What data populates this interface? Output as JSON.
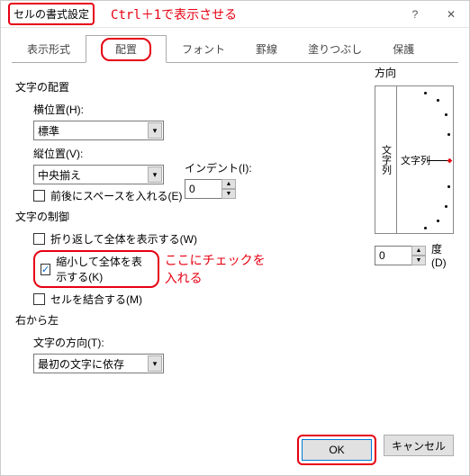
{
  "title": "セルの書式設定",
  "annotation_top": "Ctrl＋1で表示させる",
  "tabs": [
    "表示形式",
    "配置",
    "フォント",
    "罫線",
    "塗りつぶし",
    "保護"
  ],
  "active_tab": 1,
  "sections": {
    "text_align": "文字の配置",
    "horizontal_label": "横位置(H):",
    "horizontal_value": "標準",
    "vertical_label": "縦位置(V):",
    "vertical_value": "中央揃え",
    "spaces_label": "前後にスペースを入れる(E)",
    "indent_label": "インデント(I):",
    "indent_value": "0",
    "text_control": "文字の制御",
    "wrap_label": "折り返して全体を表示する(W)",
    "shrink_label": "縮小して全体を表示する(K)",
    "merge_label": "セルを結合する(M)",
    "rtl": "右から左",
    "text_dir_label": "文字の方向(T):",
    "text_dir_value": "最初の文字に依存"
  },
  "annotation_mid": "ここにチェックを入れる",
  "direction": {
    "title": "方向",
    "vert_text": "文字列",
    "dial_text": "文字列",
    "degree_value": "0",
    "degree_label": "度(D)"
  },
  "buttons": {
    "ok": "OK",
    "cancel": "キャンセル"
  }
}
